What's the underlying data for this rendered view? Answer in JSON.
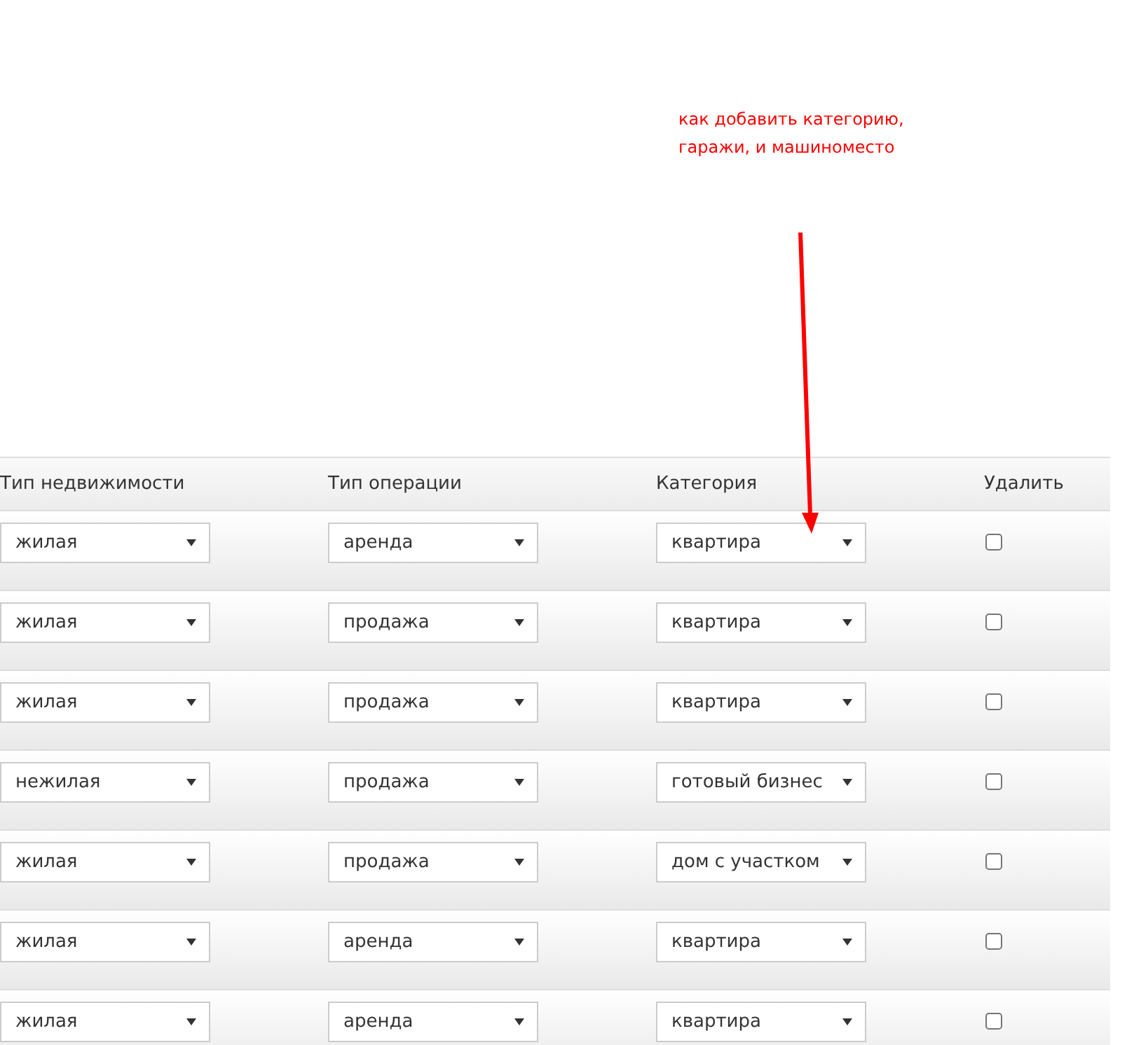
{
  "annotation": {
    "lines": [
      "как добавить категорию,",
      "гаражи, и машиноместо"
    ]
  },
  "table": {
    "columns": [
      "Тип недвижимости",
      "Тип операции",
      "Категория",
      "Удалить"
    ],
    "rows": [
      {
        "property_type": "жилая",
        "operation": "аренда",
        "category": "квартира",
        "delete": false
      },
      {
        "property_type": "жилая",
        "operation": "продажа",
        "category": "квартира",
        "delete": false
      },
      {
        "property_type": "жилая",
        "operation": "продажа",
        "category": "квартира",
        "delete": false
      },
      {
        "property_type": "нежилая",
        "operation": "продажа",
        "category": "готовый бизнес",
        "delete": false
      },
      {
        "property_type": "жилая",
        "operation": "продажа",
        "category": "дом с участком",
        "delete": false
      },
      {
        "property_type": "жилая",
        "operation": "аренда",
        "category": "квартира",
        "delete": false
      },
      {
        "property_type": "жилая",
        "operation": "аренда",
        "category": "квартира",
        "delete": false
      }
    ]
  }
}
